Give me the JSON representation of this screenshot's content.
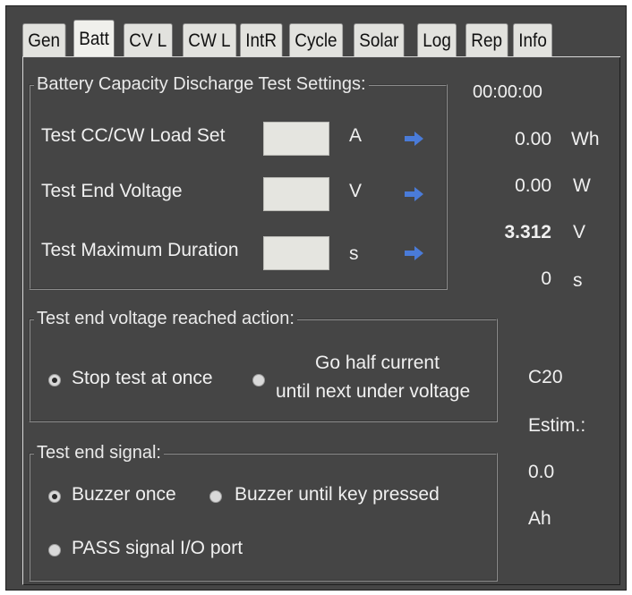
{
  "tabs": [
    {
      "label": "Gen",
      "active": false
    },
    {
      "label": "Batt",
      "active": true
    },
    {
      "label": "CV L",
      "active": false
    },
    {
      "label": "CW L",
      "active": false
    },
    {
      "label": "IntR",
      "active": false
    },
    {
      "label": "Cycle",
      "active": false
    },
    {
      "label": "Solar",
      "active": false
    },
    {
      "label": "Log",
      "active": false
    },
    {
      "label": "Rep",
      "active": false
    },
    {
      "label": "Info",
      "active": false
    }
  ],
  "settings": {
    "title": "Battery Capacity Discharge Test Settings:",
    "rows": [
      {
        "label": "Test CC/CW Load Set",
        "value": "",
        "unit": "A"
      },
      {
        "label": "Test End Voltage",
        "value": "",
        "unit": "V"
      },
      {
        "label": "Test Maximum Duration",
        "value": "",
        "unit": "s"
      }
    ],
    "arrow_icon": "right-arrow-icon",
    "arrow_color": "#4a7bd8"
  },
  "readouts": {
    "elapsed": "00:00:00",
    "energy": {
      "value": "0.00",
      "unit": "Wh"
    },
    "power": {
      "value": "0.00",
      "unit": "W"
    },
    "voltage": {
      "value": "3.312",
      "unit": "V"
    },
    "seconds": {
      "value": "0",
      "unit": "s"
    }
  },
  "end_voltage_action": {
    "title": "Test end voltage reached action:",
    "options": [
      {
        "label": "Stop test at once",
        "selected": true
      },
      {
        "label_line1": "Go half current",
        "label_line2": "until next under voltage",
        "selected": false
      }
    ]
  },
  "end_signal": {
    "title": "Test end signal:",
    "options": [
      {
        "label": "Buzzer once",
        "selected": true
      },
      {
        "label": "Buzzer until key pressed",
        "selected": false
      },
      {
        "label": "PASS signal I/O port",
        "selected": false
      }
    ]
  },
  "capacity": {
    "rate": "C20",
    "estim_label": "Estim.:",
    "value": "0.0",
    "unit": "Ah"
  },
  "colors": {
    "panel_bg": "#454545",
    "tab_bg": "#e2e2de",
    "text": "#f0f0f0"
  }
}
